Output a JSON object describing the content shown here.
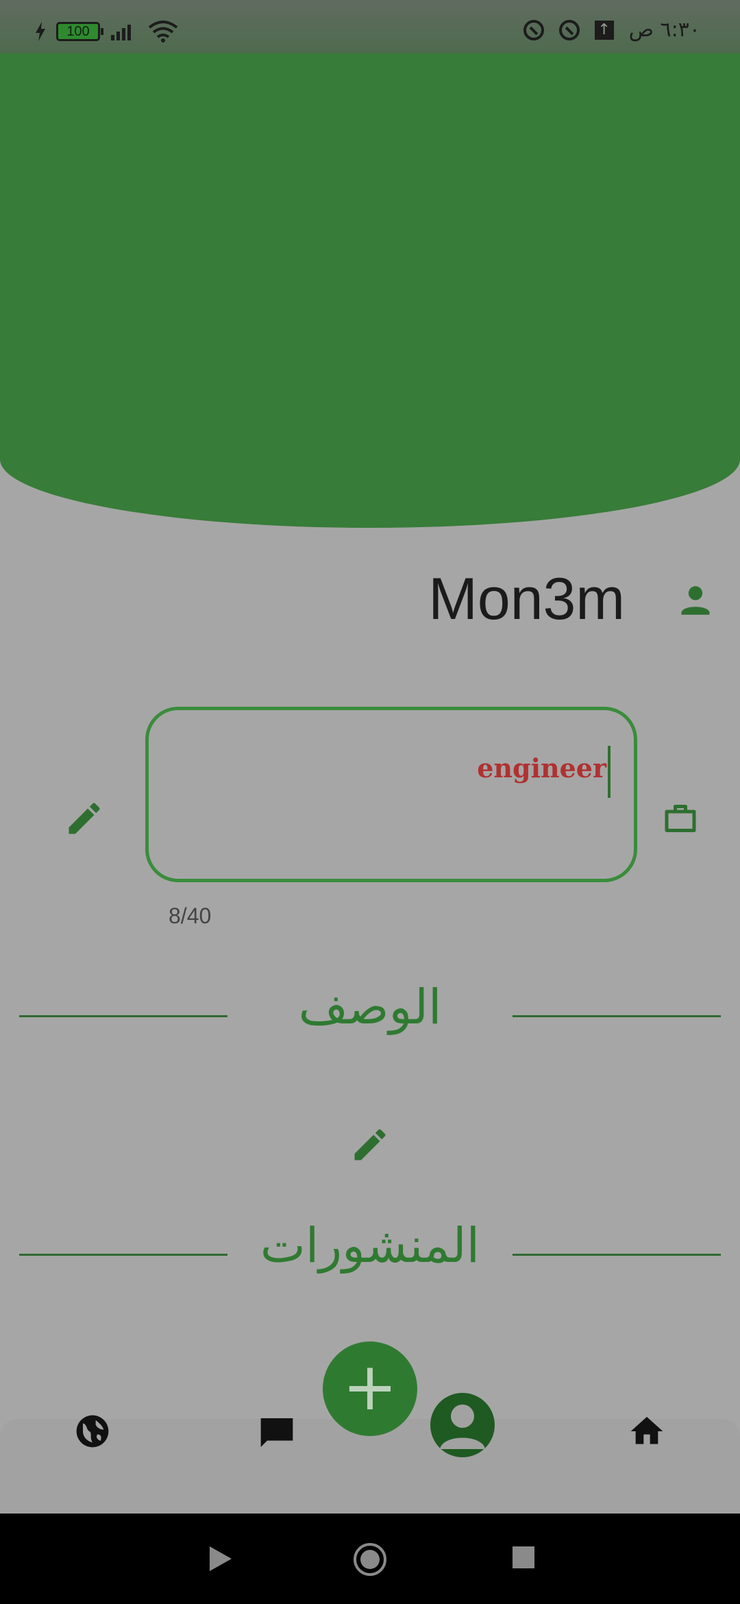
{
  "status_bar": {
    "battery": "100",
    "time": "٦:٣٠ ص"
  },
  "profile": {
    "username": "Mon3m",
    "job_field": {
      "value": "engineer",
      "counter": "8/40"
    },
    "description_title": "الوصف",
    "posts_title": "المنشورات"
  },
  "fab": {
    "label": "+"
  },
  "colors": {
    "primary_green": "#377c38",
    "dark_green": "#2f7a31",
    "scrim_gray": "#a6a6a6",
    "job_text": "#b03131"
  },
  "nav": {
    "items": [
      {
        "icon": "globe-icon"
      },
      {
        "icon": "chat-icon"
      },
      {
        "icon": "profile-icon",
        "active": true
      },
      {
        "icon": "home-icon"
      }
    ]
  }
}
